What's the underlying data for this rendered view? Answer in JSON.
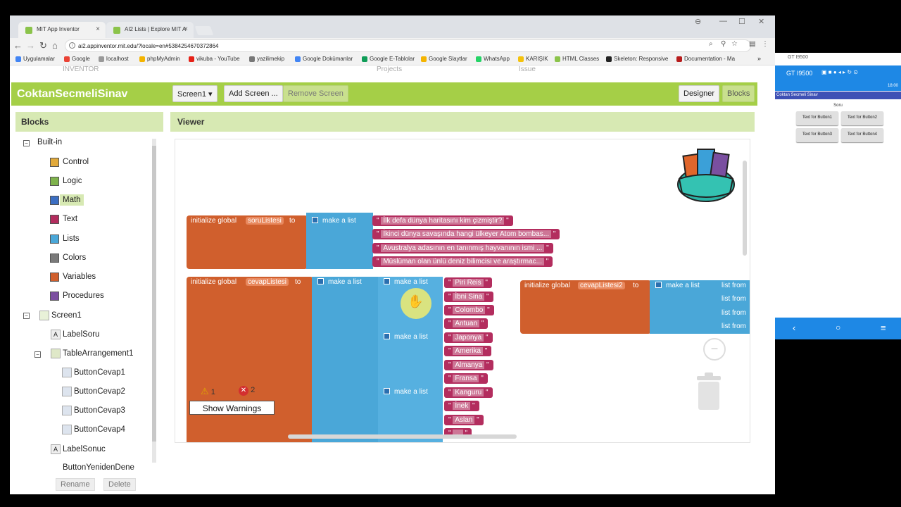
{
  "browser": {
    "tabs": [
      {
        "title": "MIT App Inventor",
        "close": "×"
      },
      {
        "title": "AI2 Lists | Explore MIT A",
        "close": "×"
      }
    ],
    "url": "ai2.appinventor.mit.edu/?locale=en#5384254670372864",
    "bookmarks": [
      "Uygulamalar",
      "Google",
      "localhost",
      "phpMyAdmin",
      "vikuba - YouTube",
      "yazilimekip",
      "Google Dokümanlar",
      "Google E-Tablolar",
      "Google Slaytlar",
      "WhatsApp",
      "KARIŞIK",
      "HTML Classes",
      "Skeleton: Responsive",
      "Documentation - Ma"
    ],
    "ghost_nav": [
      "INVENTOR",
      "Projects",
      "Issue"
    ]
  },
  "appbar": {
    "title": "CoktanSecmeliSinav",
    "screen_button": "Screen1 ▾",
    "add_screen": "Add Screen ...",
    "remove_screen": "Remove Screen",
    "designer": "Designer",
    "blocks": "Blocks"
  },
  "blocks_panel": {
    "title": "Blocks",
    "builtin": "Built-in",
    "categories": [
      {
        "label": "Control",
        "color": "#e1a93a"
      },
      {
        "label": "Logic",
        "color": "#7fb34c"
      },
      {
        "label": "Math",
        "color": "#3b6ec2"
      },
      {
        "label": "Text",
        "color": "#b32d5e"
      },
      {
        "label": "Lists",
        "color": "#4aa7d8"
      },
      {
        "label": "Colors",
        "color": "#7a7a7a"
      },
      {
        "label": "Variables",
        "color": "#d05f2d"
      },
      {
        "label": "Procedures",
        "color": "#7c4fa0"
      }
    ],
    "components": [
      "Screen1",
      "LabelSoru",
      "TableArrangement1",
      "ButtonCevap1",
      "ButtonCevap2",
      "ButtonCevap3",
      "ButtonCevap4",
      "LabelSonuc",
      "ButtonYenidenDene"
    ],
    "rename": "Rename",
    "delete": "Delete"
  },
  "viewer": {
    "title": "Viewer",
    "init_label": "initialize global",
    "to_label": "to",
    "make_list_label": "make a list",
    "list_from_label": "list from",
    "var1": "soruListesi",
    "var2": "cevapListesi",
    "var3": "cevapListesi2",
    "questions": [
      "İlk defa dünya haritasını kim çizmiştir?",
      "İkinci dünya savaşında hangi ülkeyer Atom bombas...",
      "Avustralya adasının en tanınmış hayvanının ismi ...",
      "Müslüman olan ünlü deniz bilimcisi ve araştırmac..."
    ],
    "answers": [
      "Piri Reis",
      "İbni Sina",
      "Colombo",
      "Antuan",
      "Japonya",
      "Amerika",
      "Almanya",
      "Fransa",
      "Kanguru",
      "İnek",
      "Aslan",
      "..."
    ],
    "quote": "\"",
    "warnings_count": "1",
    "errors_count": "2",
    "show_warnings": "Show Warnings"
  },
  "phone": {
    "window_title": "GT I9500",
    "device": "GT I9500",
    "status": "18:00",
    "app_title": "Coktan Secmeli Sinav",
    "label": "Soru",
    "buttons": [
      "Text for Button1",
      "Text for Button2",
      "Text for Button3",
      "Text for Button4"
    ]
  }
}
